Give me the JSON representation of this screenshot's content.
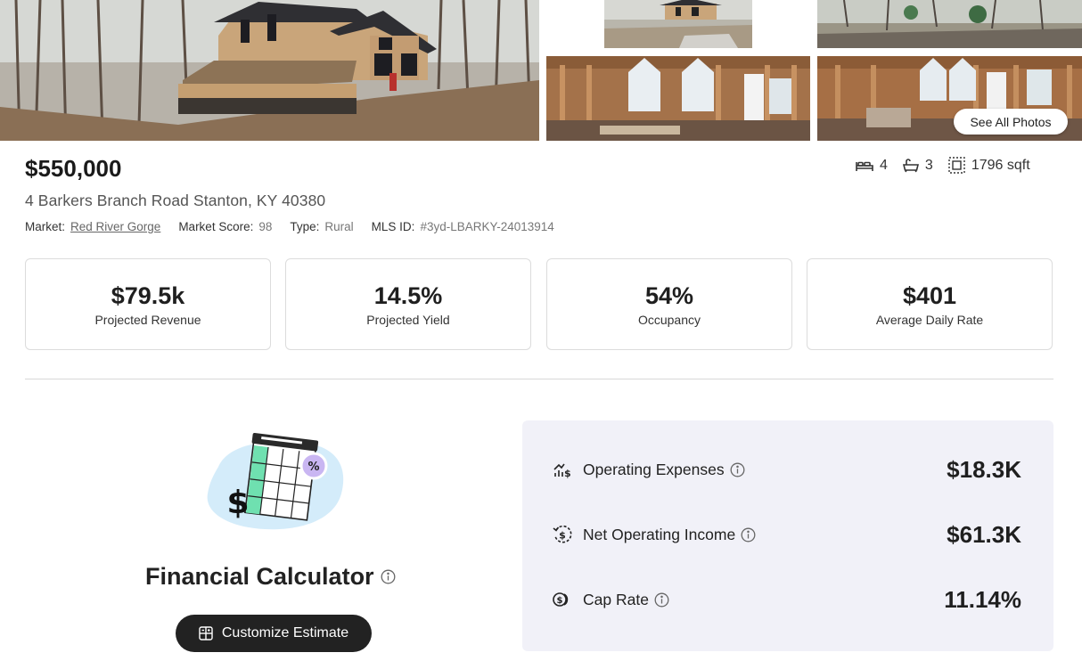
{
  "gallery": {
    "see_all_label": "See All Photos",
    "photos": [
      "main-house-photo",
      "house-front-thumbnail",
      "yard-thumbnail",
      "interior-framing-thumbnail",
      "interior-windows-thumbnail"
    ]
  },
  "listing": {
    "price": "$550,000",
    "address": "4 Barkers Branch Road Stanton, KY 40380",
    "meta": {
      "market_label": "Market:",
      "market_value": "Red River Gorge",
      "score_label": "Market Score:",
      "score_value": "98",
      "type_label": "Type:",
      "type_value": "Rural",
      "mls_label": "MLS ID:",
      "mls_value": "#3yd-LBARKY-24013914"
    },
    "specs": {
      "beds": "4",
      "baths": "3",
      "sqft": "1796 sqft"
    }
  },
  "metrics": [
    {
      "value": "$79.5k",
      "label": "Projected Revenue"
    },
    {
      "value": "14.5%",
      "label": "Projected Yield"
    },
    {
      "value": "54%",
      "label": "Occupancy"
    },
    {
      "value": "$401",
      "label": "Average Daily Rate"
    }
  ],
  "calculator": {
    "title": "Financial Calculator",
    "button_label": "Customize Estimate",
    "rows": [
      {
        "name": "Operating Expenses",
        "amount": "$18.3K",
        "icon": "expenses-chart-icon"
      },
      {
        "name": "Net Operating Income",
        "amount": "$61.3K",
        "icon": "income-cycle-icon"
      },
      {
        "name": "Cap Rate",
        "amount": "11.14%",
        "icon": "coins-icon"
      }
    ]
  },
  "colors": {
    "panel_bg": "#f1f1f8",
    "button_bg": "#222222",
    "illustration_blob": "#d4ecfa",
    "illustration_green": "#6fe0b0",
    "illustration_purple": "#c9b6f2"
  }
}
